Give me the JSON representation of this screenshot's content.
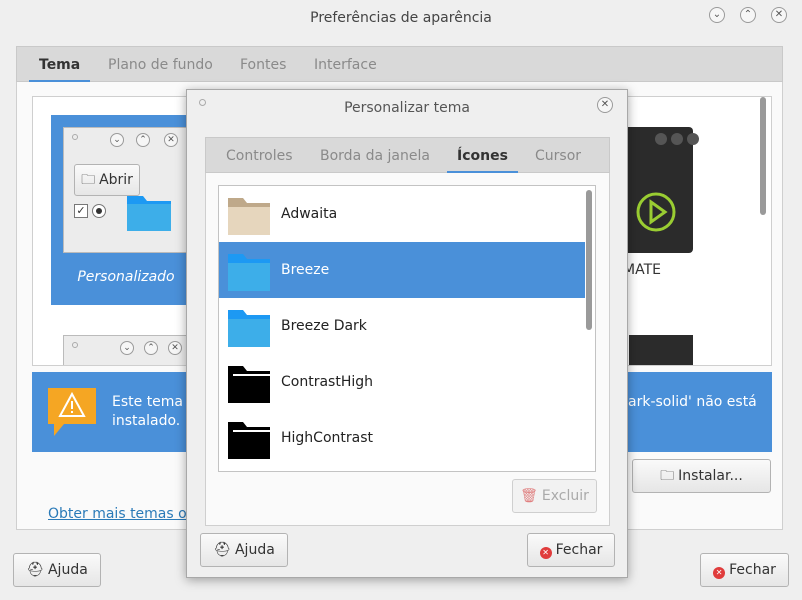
{
  "window": {
    "title": "Preferências de aparência",
    "tabs": [
      "Tema",
      "Plano de fundo",
      "Fontes",
      "Interface"
    ],
    "active_tab": "Tema",
    "theme_custom_label": "Personalizado",
    "theme_mate_label": "MATE",
    "abrir_label": "Abrir",
    "info_text_left": "Este tema n",
    "info_text_left2": "instalado.",
    "info_text_right": "ark-solid' não está",
    "install_label": "Instalar...",
    "more_themes_link": "Obter mais temas on",
    "help_label": "Ajuda",
    "close_label": "Fechar"
  },
  "dialog": {
    "title": "Personalizar tema",
    "tabs": [
      "Controles",
      "Borda da janela",
      "Ícones",
      "Cursor"
    ],
    "active_tab": "Ícones",
    "icon_themes": [
      {
        "name": "Adwaita",
        "icon": "beige-folder-icon"
      },
      {
        "name": "Breeze",
        "icon": "blue-folder-icon",
        "selected": true
      },
      {
        "name": "Breeze Dark",
        "icon": "blue-folder-icon"
      },
      {
        "name": "ContrastHigh",
        "icon": "black-folder-icon"
      },
      {
        "name": "HighContrast",
        "icon": "black-folder-icon"
      }
    ],
    "delete_label": "Excluir",
    "help_label": "Ajuda",
    "close_label": "Fechar"
  },
  "colors": {
    "accent": "#4a90d9",
    "warning": "#f5a623",
    "close_red": "#e03c3c"
  }
}
